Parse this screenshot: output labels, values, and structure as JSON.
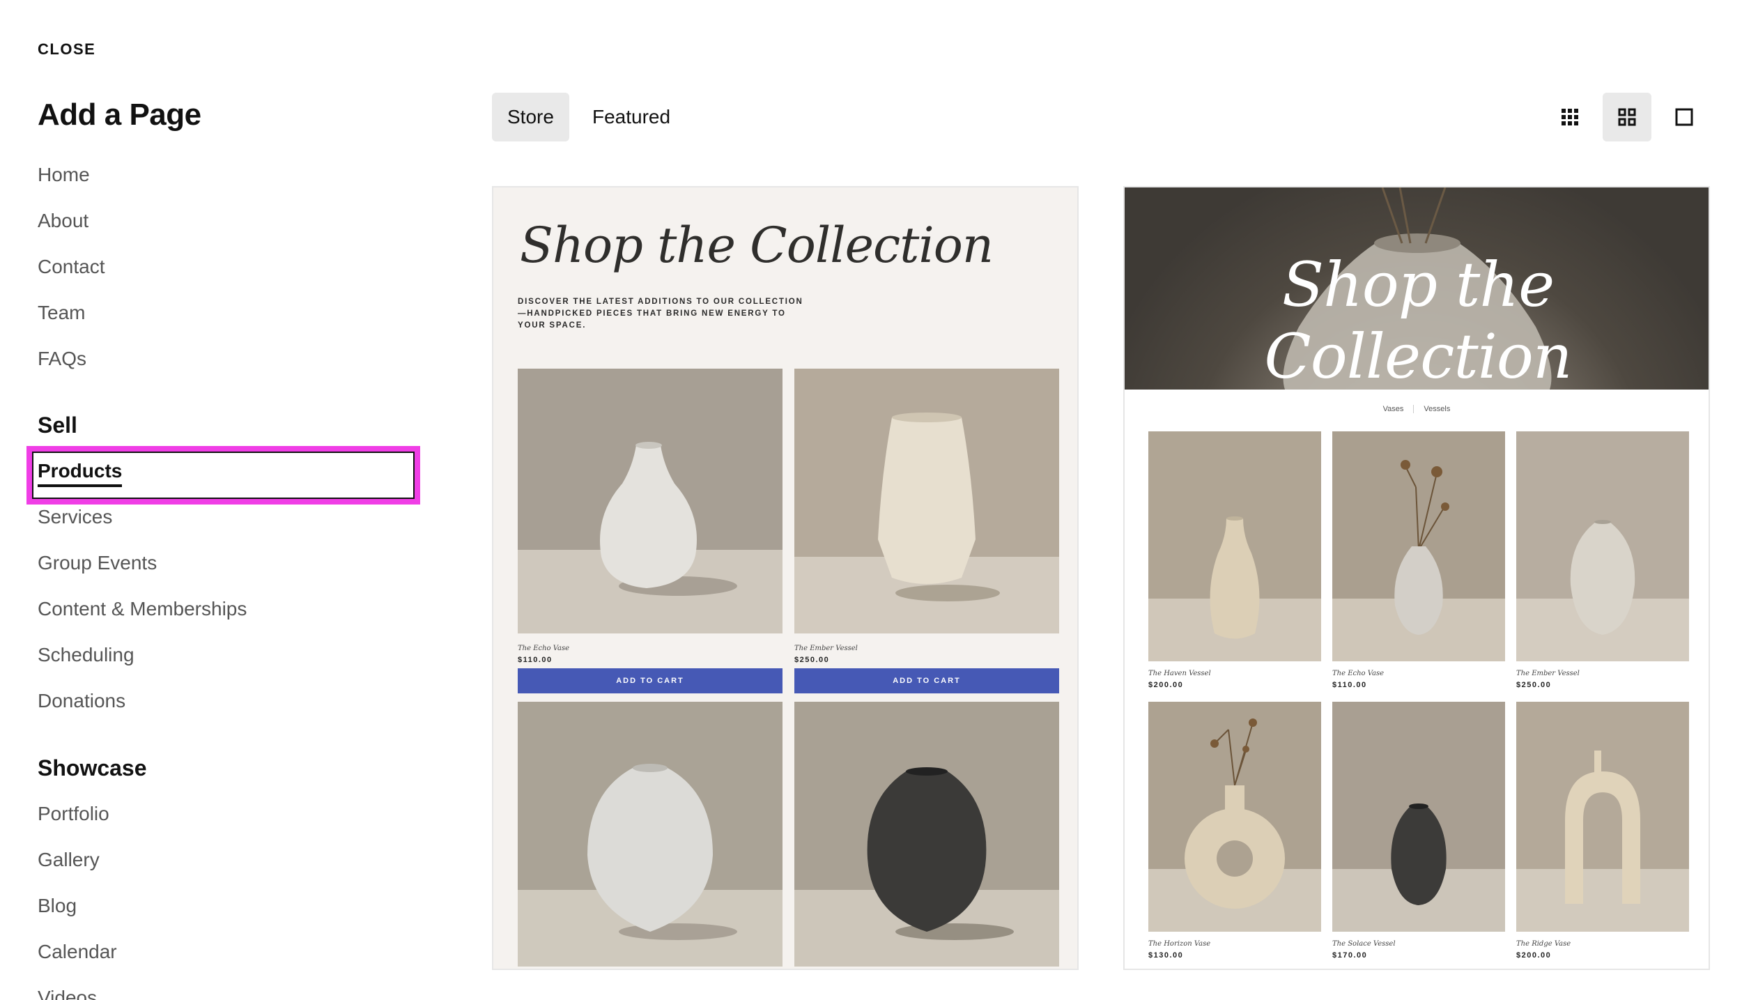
{
  "header": {
    "close_label": "CLOSE",
    "title": "Add a Page"
  },
  "sidebar": {
    "pages": [
      "Home",
      "About",
      "Contact",
      "Team",
      "FAQs"
    ],
    "sell_heading": "Sell",
    "sell": [
      "Products",
      "Services",
      "Group Events",
      "Content & Memberships",
      "Scheduling",
      "Donations"
    ],
    "showcase_heading": "Showcase",
    "showcase": [
      "Portfolio",
      "Gallery",
      "Blog",
      "Calendar",
      "Videos"
    ],
    "selected": "Products"
  },
  "tabs": [
    {
      "label": "Store",
      "active": true
    },
    {
      "label": "Featured",
      "active": false
    }
  ],
  "view_toggles": [
    {
      "icon": "grid-small-icon",
      "active": false
    },
    {
      "icon": "grid-large-icon",
      "active": true
    },
    {
      "icon": "single-square-icon",
      "active": false
    }
  ],
  "preview_1": {
    "title": "Shop the Collection",
    "description": "DISCOVER THE LATEST ADDITIONS TO OUR COLLECTION —HANDPICKED PIECES THAT BRING NEW ENERGY TO YOUR SPACE.",
    "cart_label": "ADD TO CART",
    "products": [
      {
        "name": "The Echo Vase",
        "price": "$110.00"
      },
      {
        "name": "The Ember Vessel",
        "price": "$250.00"
      }
    ]
  },
  "preview_2": {
    "title": "Shop the Collection",
    "filters": [
      "Vases",
      "Vessels"
    ],
    "products": [
      {
        "name": "The Haven Vessel",
        "price": "$200.00"
      },
      {
        "name": "The Echo Vase",
        "price": "$110.00"
      },
      {
        "name": "The Ember Vessel",
        "price": "$250.00"
      },
      {
        "name": "The Horizon Vase",
        "price": "$130.00"
      },
      {
        "name": "The Solace Vessel",
        "price": "$170.00"
      },
      {
        "name": "The Ridge Vase",
        "price": "$200.00"
      }
    ]
  },
  "colors": {
    "highlight": "#f03ee6",
    "cart_button": "#4659b5",
    "active_bg": "#e9e9e9"
  }
}
